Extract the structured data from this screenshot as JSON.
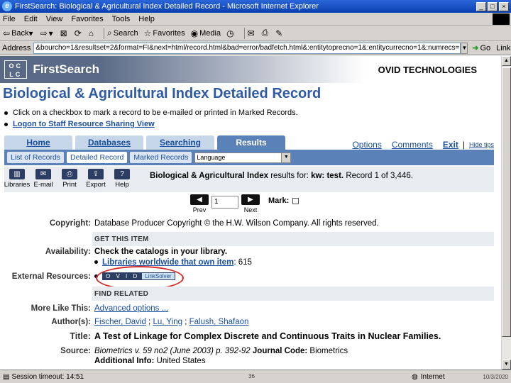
{
  "window": {
    "title": "FirstSearch: Biological & Agricultural Index Detailed Record - Microsoft Internet Explorer",
    "controls": [
      "_",
      "□",
      "×"
    ]
  },
  "menu": [
    "File",
    "Edit",
    "View",
    "Favorites",
    "Tools",
    "Help"
  ],
  "toolbar": {
    "back": "Back",
    "search": "Search",
    "favorites": "Favorites",
    "media": "Media"
  },
  "address": {
    "label": "Address",
    "url": "&bourcho=1&resultset=2&format=FI&next=html/record.html&bad=error/badfetch.html&:entitytoprecno=1&:entitycurrecno=1&:numrecs=1",
    "go": "Go",
    "links": "Links"
  },
  "header": {
    "oclc": "OCLC",
    "brand": "FirstSearch",
    "partner": "OVID TECHNOLOGIES"
  },
  "page_title": "Biological & Agricultural Index Detailed Record",
  "bullets": {
    "instruction": "Click on a checkbox to mark a record to be e-mailed or printed in Marked Records.",
    "logon": "Logon to Staff Resource Sharing View"
  },
  "tabs": [
    "Home",
    "Databases",
    "Searching",
    "Results"
  ],
  "nav_links": {
    "options": "Options",
    "comments": "Comments",
    "exit": "Exit",
    "sep": "|",
    "hide_tips": "Hide tips"
  },
  "subtabs": [
    "List of Records",
    "Detailed Record",
    "Marked Records"
  ],
  "language": "Language",
  "icons": [
    {
      "label": "Libraries",
      "icon": "library-icon"
    },
    {
      "label": "E-mail",
      "icon": "email-icon"
    },
    {
      "label": "Print",
      "icon": "print-icon"
    },
    {
      "label": "Export",
      "icon": "export-icon"
    },
    {
      "label": "Help",
      "icon": "help-icon"
    }
  ],
  "result_info": {
    "db": "Biological & Agricultural Index",
    "results_for": "results for:",
    "query": "kw: test.",
    "record": "Record 1 of 3,446."
  },
  "pager": {
    "prev": "Prev",
    "next": "Next",
    "value": "1",
    "mark": "Mark:"
  },
  "record": {
    "copyright_label": "Copyright:",
    "copyright_value": "Database Producer Copyright © the H.W. Wilson Company. All rights reserved.",
    "get_this_item": "GET THIS ITEM",
    "availability_label": "Availability:",
    "availability_value": "Check the catalogs in your library.",
    "libraries_link": "Libraries worldwide that own item",
    "libraries_count": ": 615",
    "external_label": "External Resources:",
    "linksolver_a": "O V I D",
    "linksolver_b": "LinkSolver",
    "find_related": "FIND RELATED",
    "more_label": "More Like This:",
    "more_value": "Advanced options ...",
    "authors_label": "Author(s):",
    "author1": "Fischer, David",
    "author_sep1": " ; ",
    "author2": "Lu, Ying",
    "author_sep2": " ; ",
    "author3": "Falush, Shafaon",
    "title_label": "Title:",
    "title_value": "A Test of Linkage for Complex Discrete and Continuous Traits in Nuclear Families.",
    "source_label": "Source:",
    "source_value": "Biometrics v. 59 no2 (June 2003) p. 392-92",
    "journal_code_label": "Journal Code:",
    "journal_code_value": "Biometrics",
    "additional_label": "Additional Info:",
    "additional_value": "United States"
  },
  "status": {
    "session": "Session timeout: 14:51",
    "slide_number": "36",
    "zone": "Internet",
    "date": "10/3/2020"
  }
}
